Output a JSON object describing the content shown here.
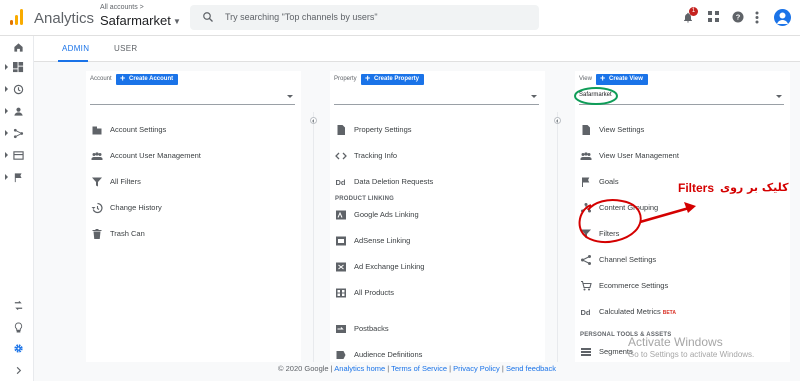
{
  "header": {
    "app_title": "Analytics",
    "account_sub": "All accounts >",
    "account_name": "Safarmarket",
    "search_placeholder": "Try searching \"Top channels by users\"",
    "notification_count": "1"
  },
  "tabs": [
    {
      "label": "ADMIN",
      "active": true
    },
    {
      "label": "USER",
      "active": false
    }
  ],
  "account": {
    "label": "Account",
    "create_label": "Create Account",
    "items": [
      {
        "label": "Account Settings",
        "icon": "building-icon"
      },
      {
        "label": "Account User Management",
        "icon": "people-icon"
      },
      {
        "label": "All Filters",
        "icon": "filter-icon"
      },
      {
        "label": "Change History",
        "icon": "history-icon"
      },
      {
        "label": "Trash Can",
        "icon": "trash-icon"
      }
    ]
  },
  "property": {
    "label": "Property",
    "create_label": "Create Property",
    "items": [
      {
        "label": "Property Settings",
        "icon": "doc-icon"
      },
      {
        "label": "Tracking Info",
        "icon": "code-icon"
      },
      {
        "label": "Data Deletion Requests",
        "icon": "dd-icon"
      }
    ],
    "product_linking_title": "PRODUCT LINKING",
    "linking_items": [
      {
        "label": "Google Ads Linking",
        "icon": "ads-icon"
      },
      {
        "label": "AdSense Linking",
        "icon": "adsense-icon"
      },
      {
        "label": "Ad Exchange Linking",
        "icon": "adx-icon"
      },
      {
        "label": "All Products",
        "icon": "grid-icon"
      },
      {
        "label": "Postbacks",
        "icon": "postback-icon"
      },
      {
        "label": "Audience Definitions",
        "icon": "audience-icon"
      }
    ]
  },
  "view": {
    "label": "View",
    "create_label": "Create View",
    "selected": "Safarmarket",
    "items": [
      {
        "label": "View Settings",
        "icon": "doc-icon"
      },
      {
        "label": "View User Management",
        "icon": "people-icon"
      },
      {
        "label": "Goals",
        "icon": "flag-icon"
      },
      {
        "label": "Content Grouping",
        "icon": "grouping-icon"
      },
      {
        "label": "Filters",
        "icon": "filter-icon"
      },
      {
        "label": "Channel Settings",
        "icon": "channel-icon"
      },
      {
        "label": "Ecommerce Settings",
        "icon": "cart-icon"
      },
      {
        "label": "Calculated Metrics",
        "icon": "dd-icon",
        "badge": "BETA"
      }
    ],
    "personal_title": "PERSONAL TOOLS & ASSETS",
    "personal_items": [
      {
        "label": "Segments",
        "icon": "segments-icon"
      }
    ]
  },
  "footer": {
    "copyright": "© 2020 Google |",
    "links": [
      "Analytics home",
      "Terms of Service",
      "Privacy Policy",
      "Send feedback"
    ]
  },
  "annotation": {
    "text_persian": "کلیک بر روی",
    "text_english": "Filters"
  },
  "watermark": {
    "line1": "Activate Windows",
    "line2": "Go to Settings to activate Windows."
  },
  "colors": {
    "accent": "#1a73e8",
    "annotation_red": "#d40000",
    "highlight_green": "#0f9d58"
  }
}
